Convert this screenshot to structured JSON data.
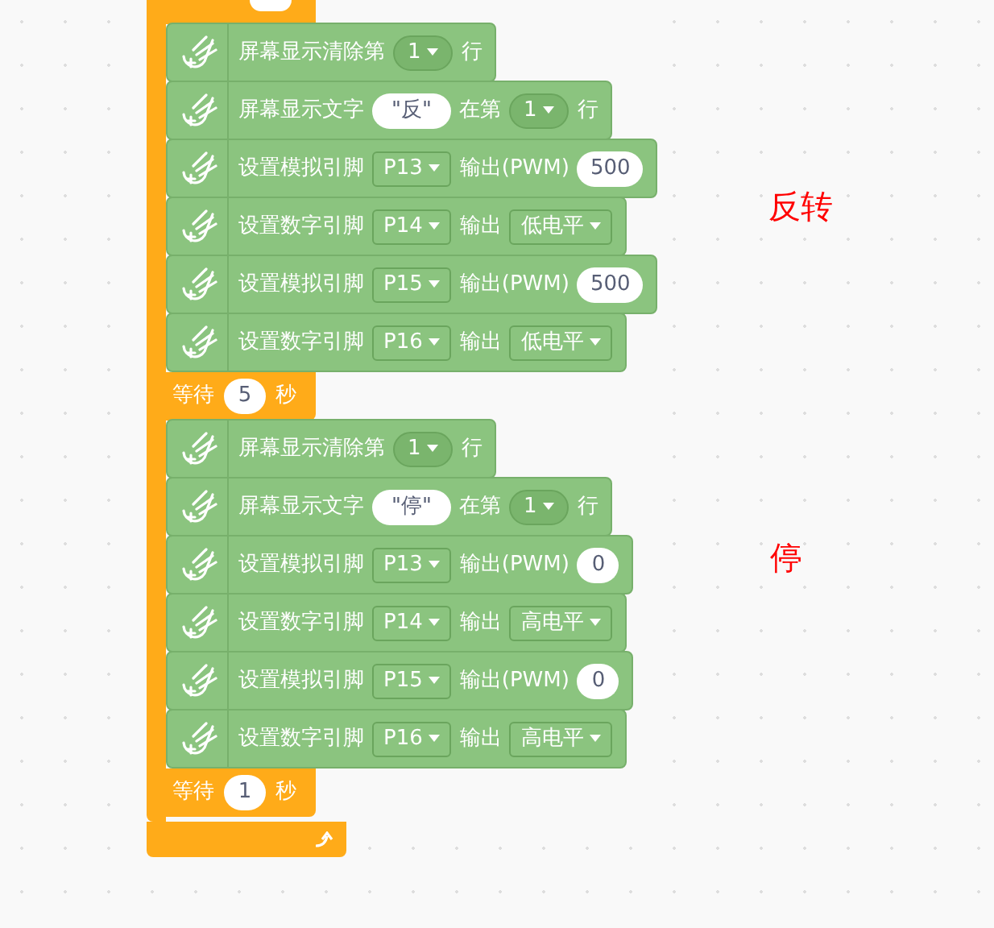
{
  "blocks": [
    {
      "kind": "wait_cut"
    },
    {
      "kind": "action",
      "parts": [
        {
          "kind": "label",
          "text": "屏幕显示清除第"
        },
        {
          "kind": "menu",
          "text": "1"
        },
        {
          "kind": "label",
          "text": "行"
        }
      ]
    },
    {
      "kind": "action",
      "parts": [
        {
          "kind": "label",
          "text": "屏幕显示文字"
        },
        {
          "kind": "string",
          "text": "\"反\""
        },
        {
          "kind": "label",
          "text": "在第"
        },
        {
          "kind": "menu",
          "text": "1"
        },
        {
          "kind": "label",
          "text": "行"
        }
      ]
    },
    {
      "kind": "action",
      "parts": [
        {
          "kind": "label",
          "text": "设置模拟引脚"
        },
        {
          "kind": "select",
          "text": "P13"
        },
        {
          "kind": "label",
          "text": "输出(PWM)"
        },
        {
          "kind": "number",
          "text": "500"
        }
      ]
    },
    {
      "kind": "action",
      "parts": [
        {
          "kind": "label",
          "text": "设置数字引脚"
        },
        {
          "kind": "select",
          "text": "P14"
        },
        {
          "kind": "label",
          "text": "输出"
        },
        {
          "kind": "select",
          "text": "低电平"
        }
      ]
    },
    {
      "kind": "action",
      "parts": [
        {
          "kind": "label",
          "text": "设置模拟引脚"
        },
        {
          "kind": "select",
          "text": "P15"
        },
        {
          "kind": "label",
          "text": "输出(PWM)"
        },
        {
          "kind": "number",
          "text": "500"
        }
      ]
    },
    {
      "kind": "action",
      "parts": [
        {
          "kind": "label",
          "text": "设置数字引脚"
        },
        {
          "kind": "select",
          "text": "P16"
        },
        {
          "kind": "label",
          "text": "输出"
        },
        {
          "kind": "select",
          "text": "低电平"
        }
      ]
    },
    {
      "kind": "wait",
      "parts": [
        {
          "kind": "label",
          "text": "等待"
        },
        {
          "kind": "number",
          "text": "5"
        },
        {
          "kind": "label",
          "text": "秒"
        }
      ]
    },
    {
      "kind": "action",
      "parts": [
        {
          "kind": "label",
          "text": "屏幕显示清除第"
        },
        {
          "kind": "menu",
          "text": "1"
        },
        {
          "kind": "label",
          "text": "行"
        }
      ]
    },
    {
      "kind": "action",
      "parts": [
        {
          "kind": "label",
          "text": "屏幕显示文字"
        },
        {
          "kind": "string",
          "text": "\"停\""
        },
        {
          "kind": "label",
          "text": "在第"
        },
        {
          "kind": "menu",
          "text": "1"
        },
        {
          "kind": "label",
          "text": "行"
        }
      ]
    },
    {
      "kind": "action",
      "parts": [
        {
          "kind": "label",
          "text": "设置模拟引脚"
        },
        {
          "kind": "select",
          "text": "P13"
        },
        {
          "kind": "label",
          "text": "输出(PWM)"
        },
        {
          "kind": "number",
          "text": "0"
        }
      ]
    },
    {
      "kind": "action",
      "parts": [
        {
          "kind": "label",
          "text": "设置数字引脚"
        },
        {
          "kind": "select",
          "text": "P14"
        },
        {
          "kind": "label",
          "text": "输出"
        },
        {
          "kind": "select",
          "text": "高电平"
        }
      ]
    },
    {
      "kind": "action",
      "parts": [
        {
          "kind": "label",
          "text": "设置模拟引脚"
        },
        {
          "kind": "select",
          "text": "P15"
        },
        {
          "kind": "label",
          "text": "输出(PWM)"
        },
        {
          "kind": "number",
          "text": "0"
        }
      ]
    },
    {
      "kind": "action",
      "parts": [
        {
          "kind": "label",
          "text": "设置数字引脚"
        },
        {
          "kind": "select",
          "text": "P16"
        },
        {
          "kind": "label",
          "text": "输出"
        },
        {
          "kind": "select",
          "text": "高电平"
        }
      ]
    },
    {
      "kind": "wait",
      "parts": [
        {
          "kind": "label",
          "text": "等待"
        },
        {
          "kind": "number",
          "text": "1"
        },
        {
          "kind": "label",
          "text": "秒"
        }
      ]
    }
  ],
  "comments": [
    {
      "text": "反转"
    },
    {
      "text": "停"
    }
  ]
}
